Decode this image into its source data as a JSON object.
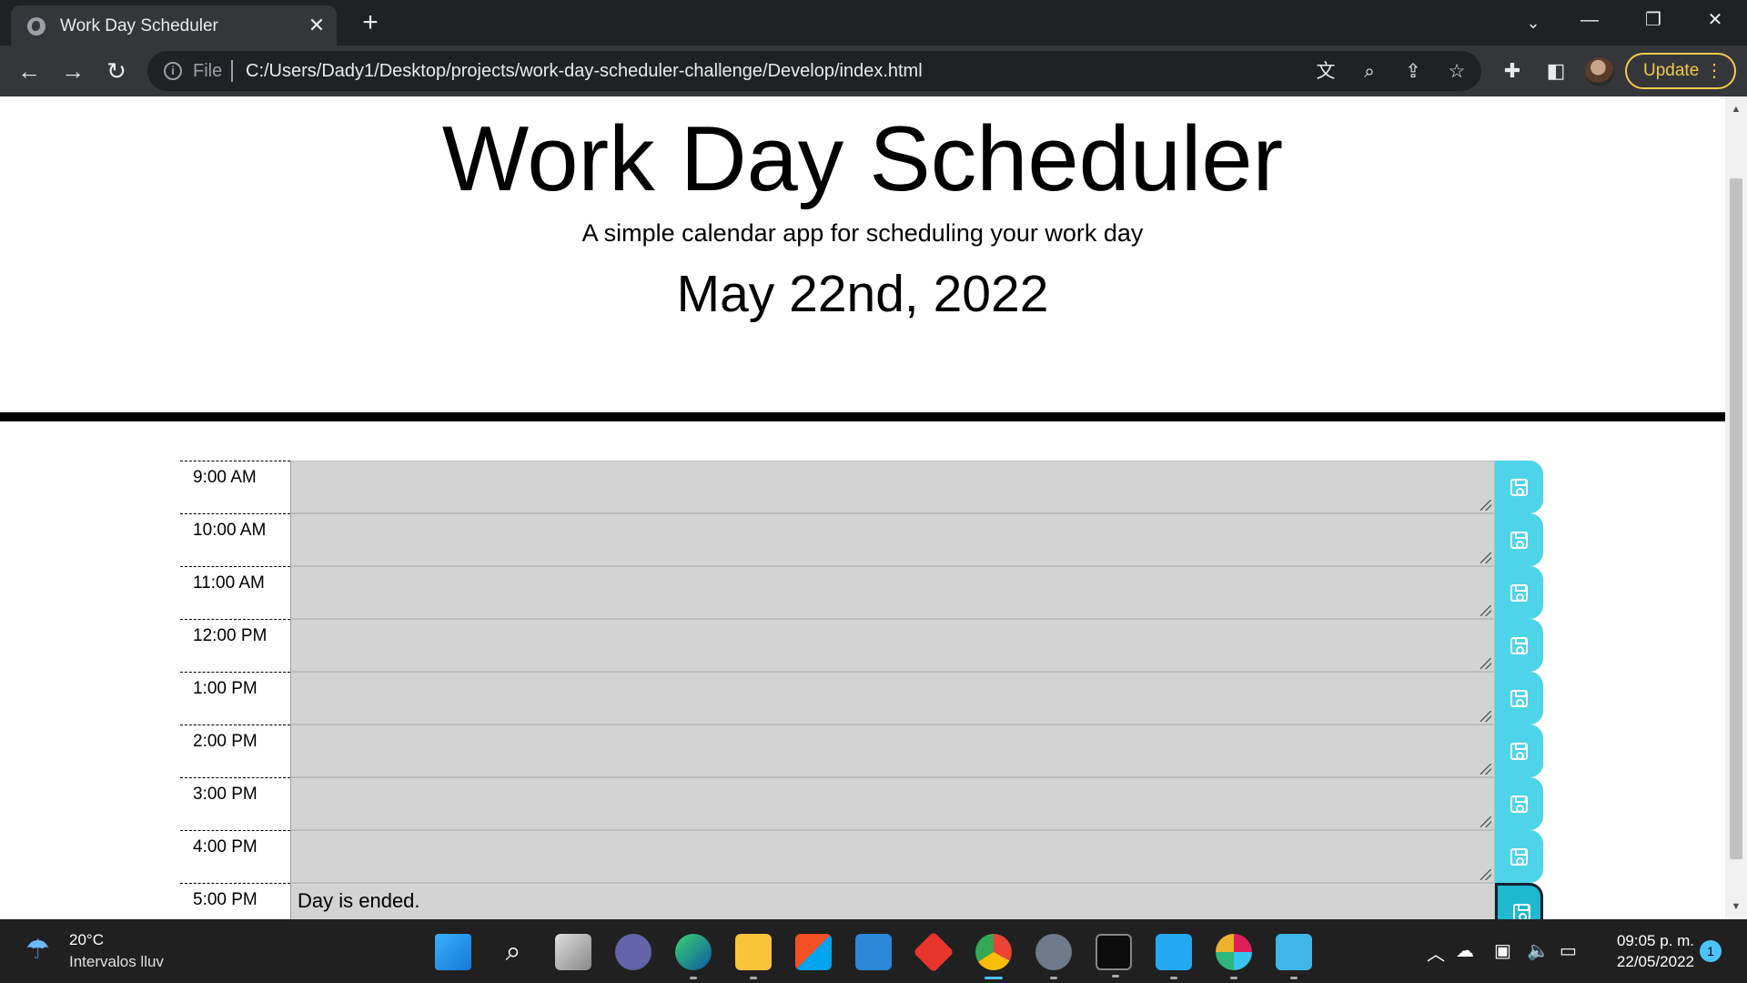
{
  "browser": {
    "tab_title": "Work Day Scheduler",
    "scheme": "File",
    "url": "C:/Users/Dady1/Desktop/projects/work-day-scheduler-challenge/Develop/index.html",
    "update_label": "Update"
  },
  "header": {
    "title": "Work Day Scheduler",
    "lead": "A simple calendar app for scheduling your work day",
    "current_day": "May 22nd, 2022"
  },
  "schedule": {
    "rows": [
      {
        "hour": "9:00 AM",
        "text": ""
      },
      {
        "hour": "10:00 AM",
        "text": ""
      },
      {
        "hour": "11:00 AM",
        "text": ""
      },
      {
        "hour": "12:00 PM",
        "text": ""
      },
      {
        "hour": "1:00 PM",
        "text": ""
      },
      {
        "hour": "2:00 PM",
        "text": ""
      },
      {
        "hour": "3:00 PM",
        "text": ""
      },
      {
        "hour": "4:00 PM",
        "text": ""
      },
      {
        "hour": "5:00 PM",
        "text": "Day is ended."
      }
    ]
  },
  "taskbar": {
    "weather_temp": "20°C",
    "weather_desc": "Intervalos lluv",
    "clock_time": "09:05 p. m.",
    "clock_date": "22/05/2022",
    "notification_count": "1"
  },
  "colors": {
    "past_row": "#d3d3d3",
    "save_button": "#4dd4e8",
    "update_accent": "#f2c94c"
  }
}
